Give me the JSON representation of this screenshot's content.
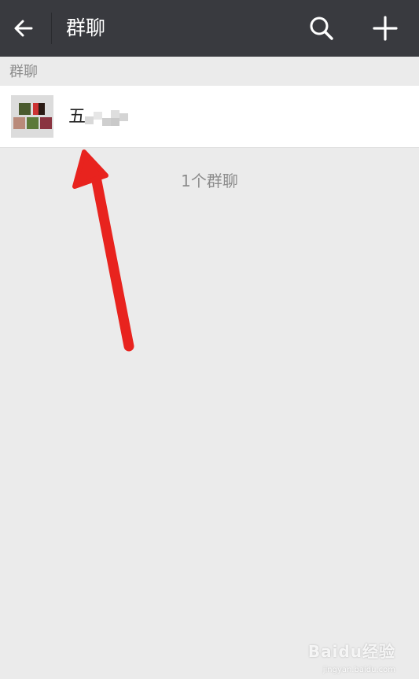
{
  "header": {
    "title": "群聊"
  },
  "section": {
    "label": "群聊"
  },
  "groups": [
    {
      "name": "五"
    }
  ],
  "footer": {
    "count_label": "1个群聊"
  },
  "watermark": {
    "logo": "Baidu经验",
    "url": "jingyan.baidu.com"
  },
  "colors": {
    "header_bg": "#393a3f",
    "page_bg": "#ebebeb",
    "arrow": "#e8231e"
  },
  "icons": [
    "back-arrow-icon",
    "search-icon",
    "plus-icon",
    "group-avatar",
    "red-arrow-annotation"
  ]
}
